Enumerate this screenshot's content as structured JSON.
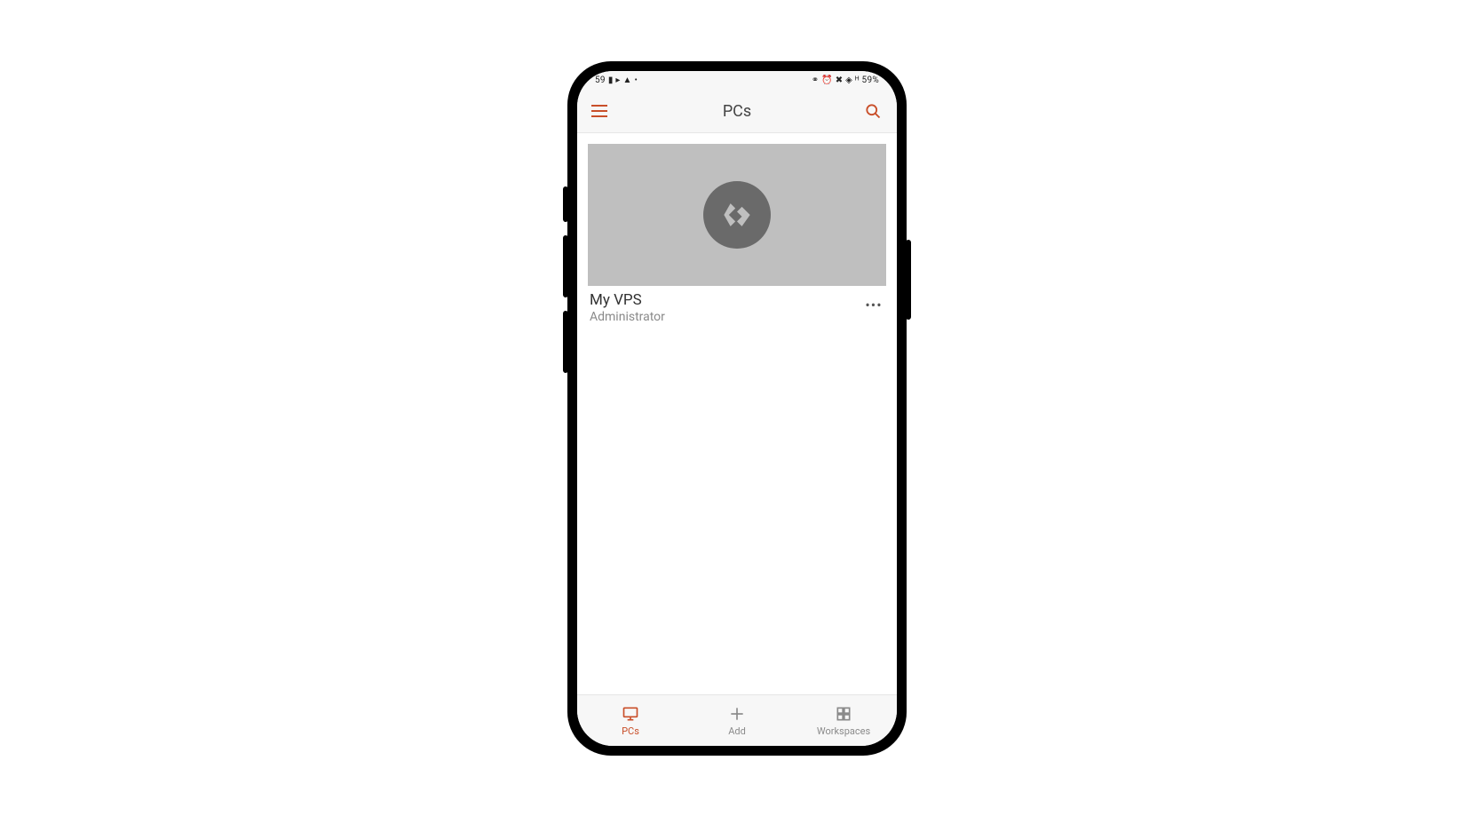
{
  "status": {
    "time_partial": "59",
    "battery": "59%",
    "left_icons": "▮ ▸ ▲ •",
    "right_icons": "⚭ ⏰ ✖ ◈ ᴴ"
  },
  "header": {
    "title": "PCs"
  },
  "pcs": [
    {
      "name": "My VPS",
      "user": "Administrator"
    }
  ],
  "nav": {
    "pcs": "PCs",
    "add": "Add",
    "workspaces": "Workspaces"
  },
  "colors": {
    "accent": "#c94f2a"
  }
}
